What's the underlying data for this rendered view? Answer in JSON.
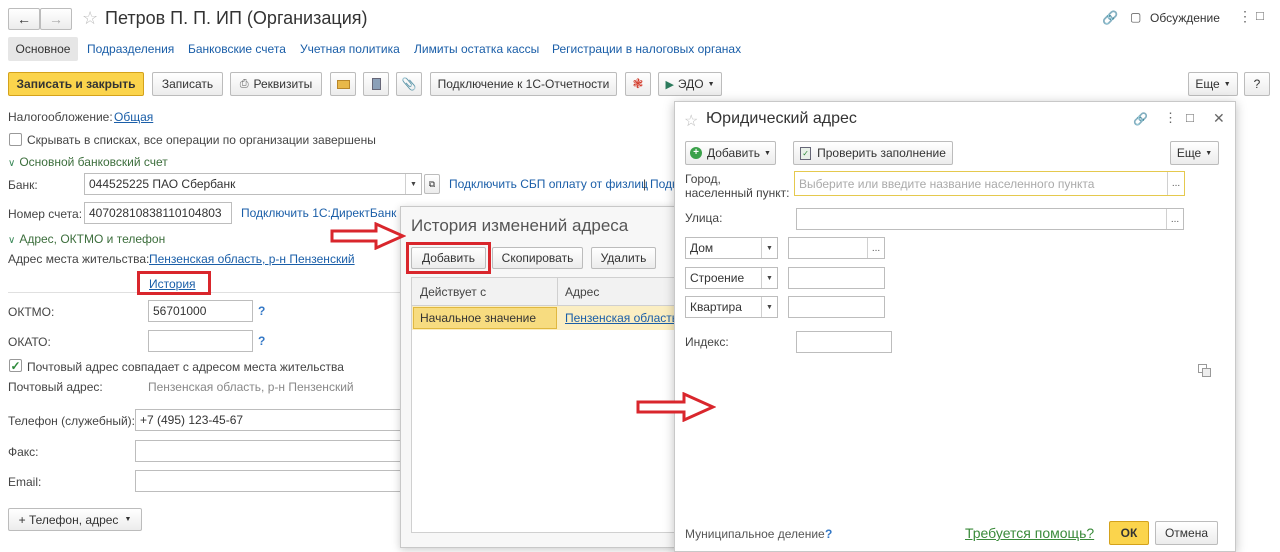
{
  "window": {
    "title": "Петров П. П. ИП (Организация)",
    "discuss": "Обсуждение"
  },
  "tabs": [
    "Основное",
    "Подразделения",
    "Банковские счета",
    "Учетная политика",
    "Лимиты остатка кассы",
    "Регистрации в налоговых органах"
  ],
  "toolbar": {
    "save_close": "Записать и закрыть",
    "save": "Записать",
    "requisites": "Реквизиты",
    "connect": "Подключение к 1С-Отчетности",
    "edo": "ЭДО",
    "more": "Еще"
  },
  "form": {
    "tax_label": "Налогообложение:",
    "tax_link": "Общая",
    "hide_label": "Скрывать в списках, все операции по организации завершены",
    "bank_section": "Основной банковский счет",
    "bank_label": "Банк:",
    "bank_value": "044525225 ПАО Сбербанк",
    "sbp_link": "Подключить СБП оплату от физлиц",
    "sbp_link2": "Подк",
    "account_label": "Номер счета:",
    "account_value": "40702810838110104803",
    "direct_link": "Подключить 1С:ДиректБанк",
    "addr_section": "Адрес, ОКТМО и телефон",
    "residence_label": "Адрес места жительства:",
    "residence_link": "Пензенская область, р-н Пензенский",
    "history_link": "История",
    "oktmo_label": "ОКТМО:",
    "oktmo_value": "56701000",
    "okato_label": "ОКАТО:",
    "postal_same_label": "Почтовый адрес совпадает с адресом места жительства",
    "postal_label": "Почтовый адрес:",
    "postal_value": "Пензенская область, р-н Пензенский",
    "phone_label": "Телефон (служебный):",
    "phone_value": "+7 (495) 123-45-67",
    "fax_label": "Факс:",
    "email_label": "Email:",
    "add_contact": "+ Телефон, адрес",
    "help_q": "?"
  },
  "history": {
    "title": "История изменений адреса",
    "add": "Добавить",
    "copy": "Скопировать",
    "delete": "Удалить",
    "col1": "Действует с",
    "col2": "Адрес",
    "row_date": "Начальное значение",
    "row_addr": "Пензенская область"
  },
  "legal": {
    "title": "Юридический адрес",
    "add": "Добавить",
    "check": "Проверить заполнение",
    "more": "Еще",
    "city_label": "Город, населенный пункт:",
    "city_placeholder": "Выберите или введите название населенного пункта",
    "street_label": "Улица:",
    "house": "Дом",
    "building": "Строение",
    "flat": "Квартира",
    "index_label": "Индекс:",
    "municipal": "Муниципальное деление",
    "help": "Требуется помощь?",
    "ok": "ОК",
    "cancel": "Отмена"
  },
  "colors": {
    "accent_yellow": "#fbd44c",
    "link_blue": "#1a5ea8",
    "section_green": "#3c6e3c",
    "highlight_red": "#d9262c"
  }
}
